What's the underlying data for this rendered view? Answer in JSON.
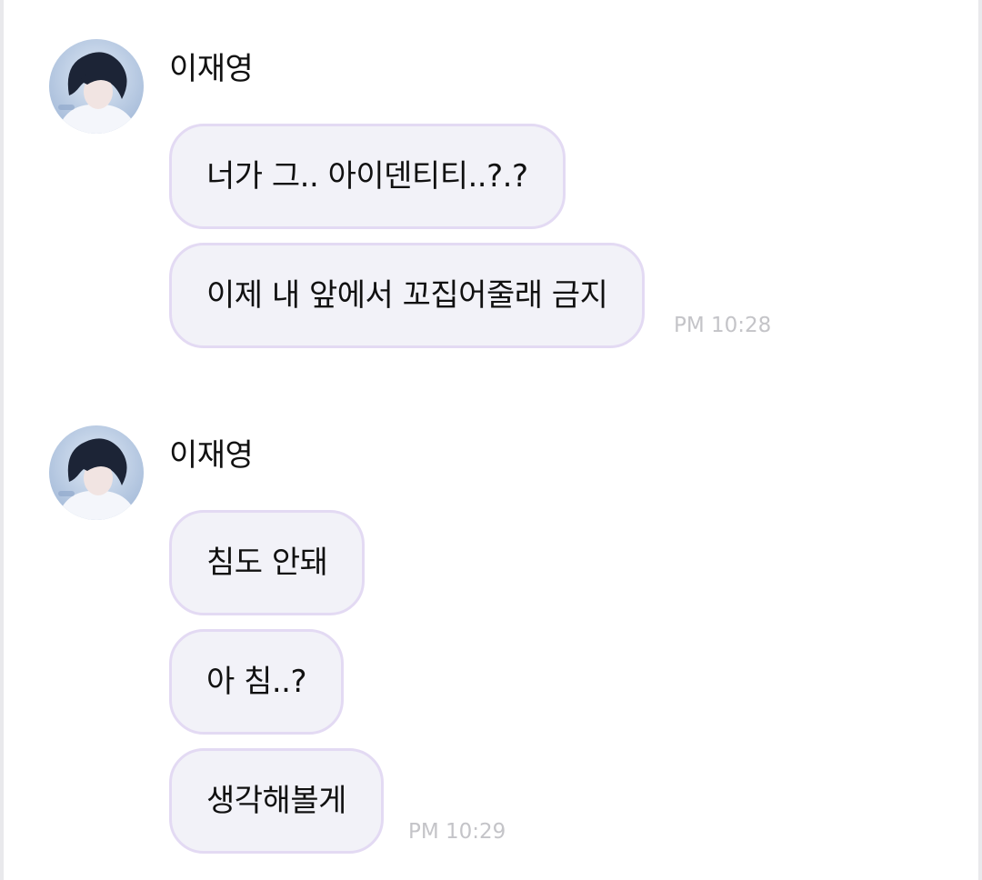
{
  "chat": {
    "groups": [
      {
        "sender": "이재영",
        "avatar_icon": "profile-photo-avatar",
        "messages": [
          "너가 그.. 아이덴티티..?.?",
          "이제 내 앞에서 꼬집어줄래 금지"
        ],
        "time": "PM 10:28"
      },
      {
        "sender": "이재영",
        "avatar_icon": "profile-photo-avatar",
        "messages": [
          "침도 안돼",
          "아 침..?",
          "생각해볼게"
        ],
        "time": "PM 10:29"
      }
    ]
  },
  "colors": {
    "bubble_bg": "#f2f2f8",
    "bubble_border": "#e3daf3",
    "timestamp": "#c4c4c8",
    "text": "#111111"
  }
}
